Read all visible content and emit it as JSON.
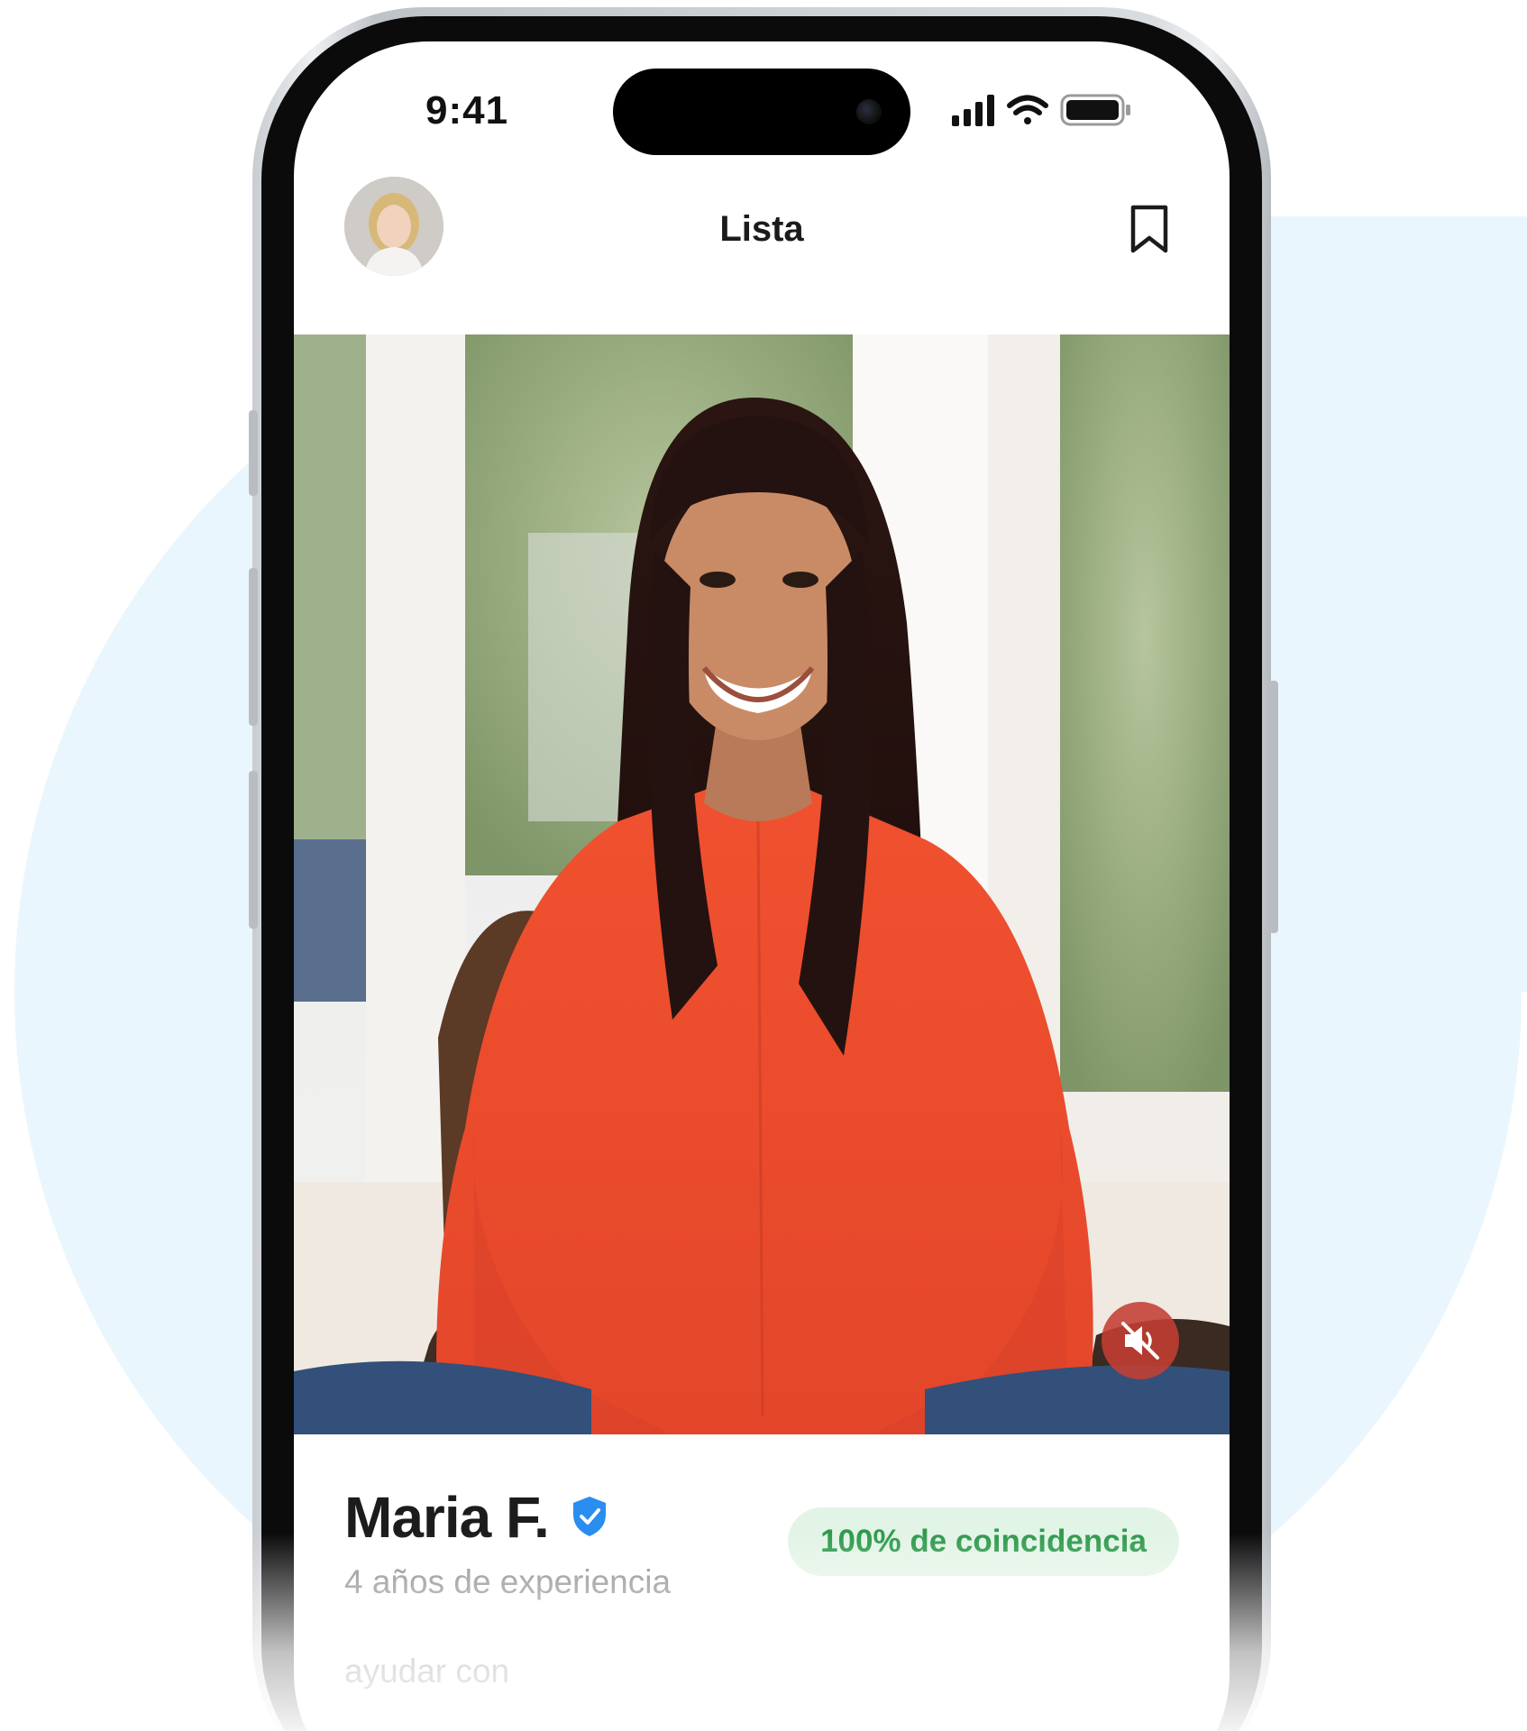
{
  "status_bar": {
    "time": "9:41",
    "icons": [
      "cellular-signal-icon",
      "wifi-icon",
      "battery-icon"
    ]
  },
  "nav": {
    "title": "Lista",
    "avatar_icon": "user-avatar",
    "bookmark_icon": "bookmark-icon"
  },
  "video": {
    "mute_icon": "speaker-muted-icon"
  },
  "profile": {
    "name": "Maria F.",
    "verified_icon": "verified-shield-icon",
    "experience": "4 años de experiencia",
    "match": "100% de coincidencia",
    "help_text": "ayudar con"
  },
  "colors": {
    "background_circle": "#eaf6fd",
    "match_badge_bg": "#e2f4e6",
    "match_badge_text": "#2f9a4d",
    "verified": "#2a8df0",
    "mute_button": "#c43e32"
  }
}
